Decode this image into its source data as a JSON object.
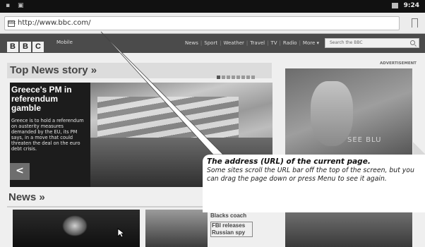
{
  "statusbar": {
    "left": "▪ ▣",
    "time": "9:24"
  },
  "urlbar": {
    "favicon_text": "BBC",
    "url": "http://www.bbc.com/"
  },
  "bbc": {
    "logo": [
      "B",
      "B",
      "C"
    ],
    "mobile": "Mobile",
    "nav": [
      "News",
      "Sport",
      "Weather",
      "Travel",
      "TV",
      "Radio",
      "More ▾"
    ],
    "search_placeholder": "Search the BBC"
  },
  "top_story": {
    "heading": "Top News story »",
    "headline": "Greece's PM in referendum gamble",
    "summary": "Greece is to hold a referendum on austerity measures demanded by the EU, its PM says, in a move that could threaten the deal on the euro debt crisis.",
    "prev_label": "<"
  },
  "news": {
    "heading": "News »",
    "item1": "Blacks coach",
    "item2": "FBI releases Russian spy"
  },
  "ad": {
    "label": "ADVERTISEMENT",
    "overlay_text": "SEE BLU"
  },
  "callout": {
    "title": "The address (URL) of the current page.",
    "body": "Some sites scroll the URL bar off the top of the screen, but you can drag the page down or press Menu to see it again."
  }
}
